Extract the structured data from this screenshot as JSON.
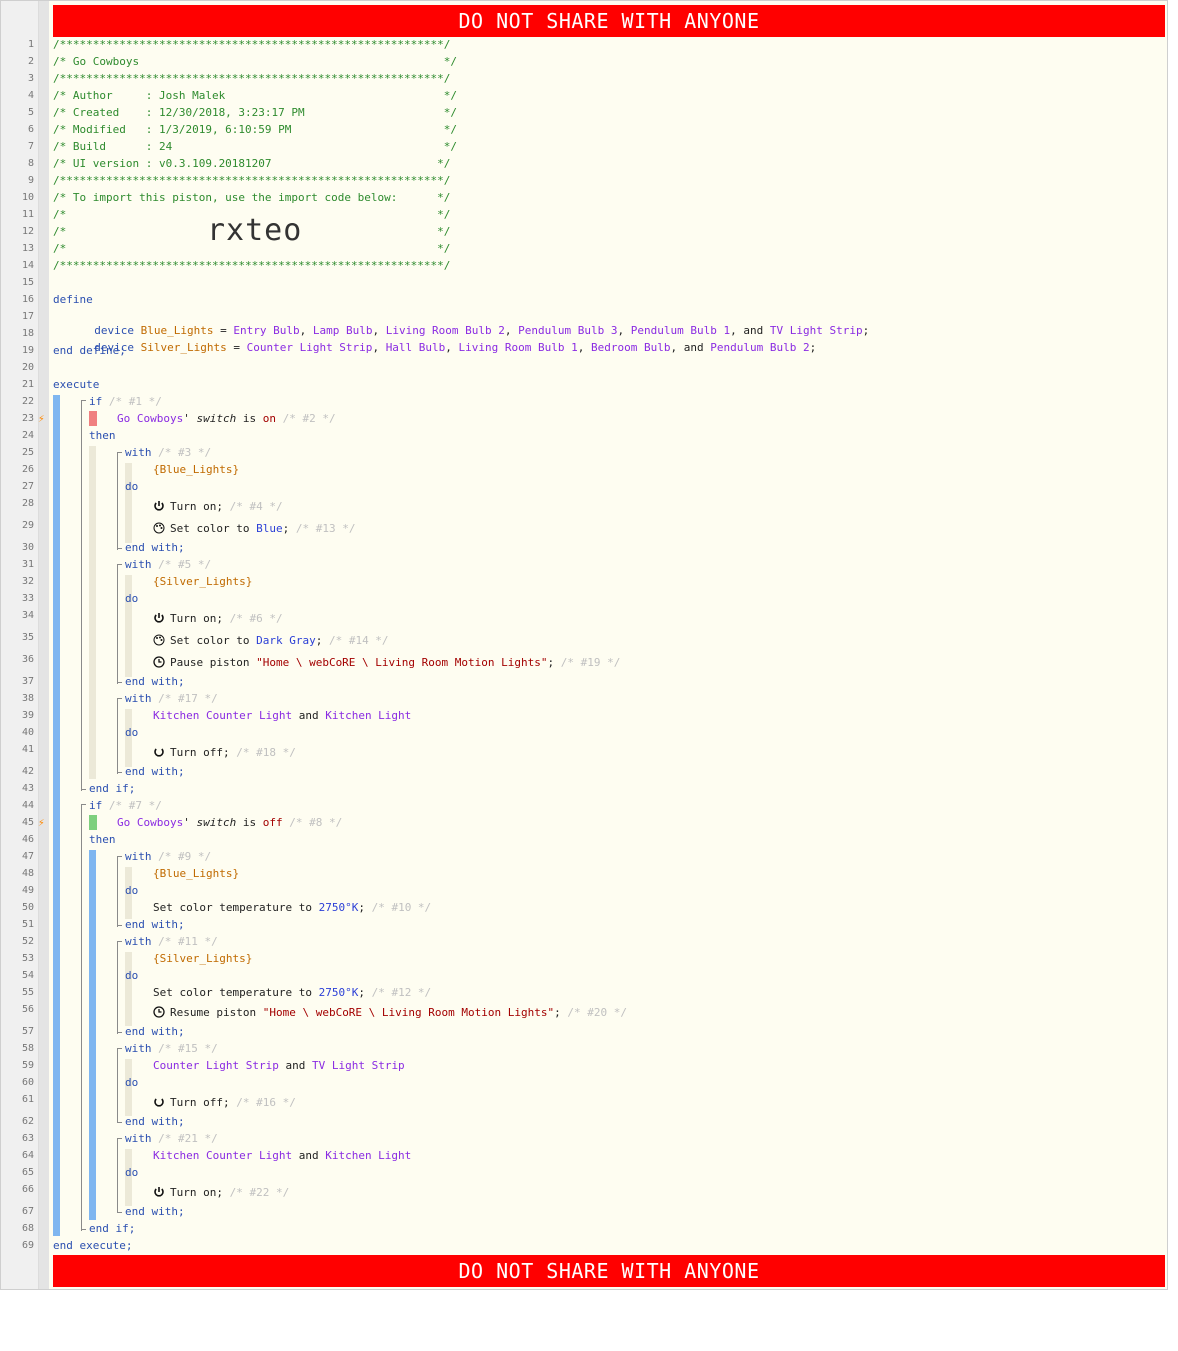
{
  "banner": {
    "text": "DO NOT SHARE WITH ANYONE"
  },
  "import_code": "rxteo",
  "line_numbers": [
    "1",
    "2",
    "3",
    "4",
    "5",
    "6",
    "7",
    "8",
    "9",
    "10",
    "11",
    "12",
    "13",
    "14",
    "15",
    "16",
    "17",
    "18",
    "19",
    "20",
    "21",
    "22",
    "23",
    "24",
    "25",
    "26",
    "27",
    "28",
    "29",
    "30",
    "31",
    "32",
    "33",
    "34",
    "35",
    "36",
    "37",
    "38",
    "39",
    "40",
    "41",
    "42",
    "43",
    "44",
    "45",
    "46",
    "47",
    "48",
    "49",
    "50",
    "51",
    "52",
    "53",
    "54",
    "55",
    "56",
    "57",
    "58",
    "59",
    "60",
    "61",
    "62",
    "63",
    "64",
    "65",
    "66",
    "67",
    "68",
    "69"
  ],
  "header": {
    "border": "/**********************************************************/",
    "title": "/* Go Cowboys                                              */",
    "author": "/* Author     : Josh Malek                                 */",
    "created": "/* Created    : 12/30/2018, 3:23:17 PM                     */",
    "modified": "/* Modified   : 1/3/2019, 6:10:59 PM                       */",
    "build": "/* Build      : 24                                         */",
    "ui_version": "/* UI version : v0.3.109.20181207                         */",
    "import_note": "/* To import this piston, use the import code below:      */",
    "blank": "/*                                                        */"
  },
  "define": {
    "open": "define",
    "close": "end define;",
    "blue_decl": {
      "kw": "device",
      "name": "Blue_Lights",
      "eq": " = ",
      "devices": [
        "Entry Bulb",
        "Lamp Bulb",
        "Living Room Bulb 2",
        "Pendulum Bulb 3",
        "Pendulum Bulb 1"
      ],
      "last": "TV Light Strip"
    },
    "silver_decl": {
      "kw": "device",
      "name": "Silver_Lights",
      "eq": " = ",
      "devices": [
        "Counter Light Strip",
        "Hall Bulb",
        "Living Room Bulb 1",
        "Bedroom Bulb"
      ],
      "last": "Pendulum Bulb 2"
    },
    "and": "and",
    "comma": ", ",
    "semi": ";"
  },
  "execute": {
    "open": "execute",
    "close": "end execute;",
    "if1": {
      "kw": "if",
      "id": "/* #1 */",
      "cond": {
        "device": "Go Cowboys",
        "apos": "'",
        "attr": "switch",
        "is": "is",
        "value": "on",
        "id": "/* #2 */"
      },
      "then": "then",
      "end": "end if;"
    },
    "if2": {
      "kw": "if",
      "id": "/* #7 */",
      "cond": {
        "device": "Go Cowboys",
        "apos": "'",
        "attr": "switch",
        "is": "is",
        "value": "off",
        "id": "/* #8 */"
      },
      "then": "then",
      "end": "end if;"
    },
    "with_kw": "with",
    "do_kw": "do",
    "end_with": "end with;",
    "ids": {
      "w3": "/* #3 */",
      "a4": "/* #4 */",
      "a13": "/* #13 */",
      "w5": "/* #5 */",
      "a6": "/* #6 */",
      "a14": "/* #14 */",
      "a19": "/* #19 */",
      "w17": "/* #17 */",
      "a18": "/* #18 */",
      "w9": "/* #9 */",
      "a10": "/* #10 */",
      "w11": "/* #11 */",
      "a12": "/* #12 */",
      "a20": "/* #20 */",
      "w15": "/* #15 */",
      "a16": "/* #16 */",
      "w21": "/* #21 */",
      "a22": "/* #22 */"
    },
    "vars": {
      "blue": "{Blue_Lights}",
      "silver": "{Silver_Lights}"
    },
    "devices": {
      "kitchen_counter": "Kitchen Counter Light",
      "kitchen": "Kitchen Light",
      "counter_strip": "Counter Light Strip",
      "tv_strip": "TV Light Strip"
    },
    "actions": {
      "turn_on": "Turn on;",
      "turn_off": "Turn off;",
      "set_color": "Set color to ",
      "blue": "Blue",
      "dark_gray": "Dark Gray",
      "set_temp": "Set color temperature to ",
      "temp_val": "2750°K",
      "pause": "Pause piston ",
      "resume": "Resume piston ",
      "piston_name": "\"Home \\ webCoRE \\ Living Room Motion Lights\""
    }
  }
}
